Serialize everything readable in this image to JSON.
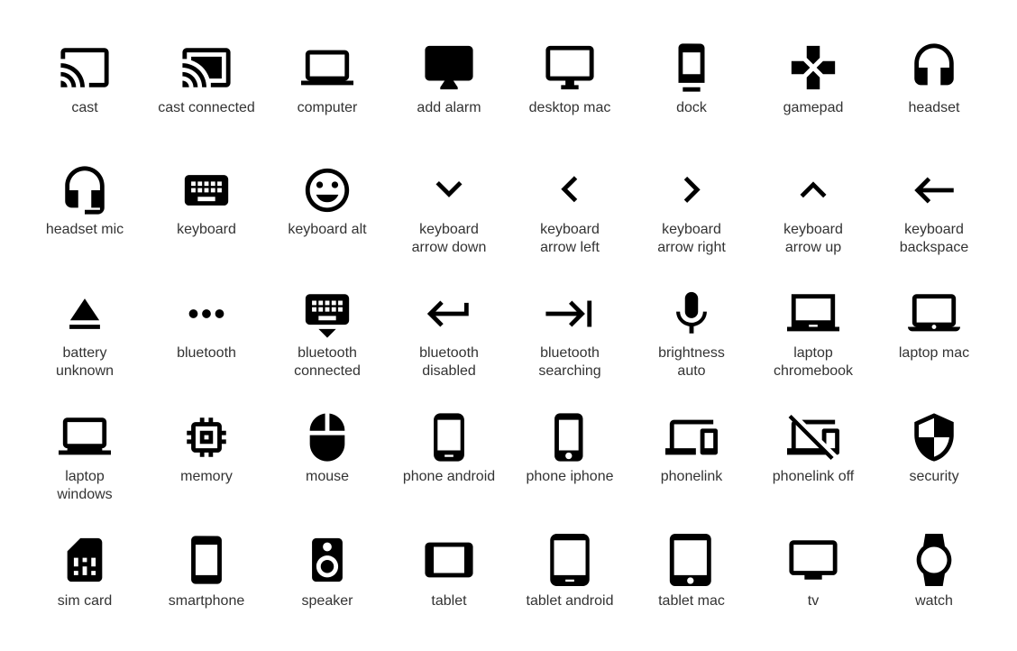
{
  "icon_color": "#000000",
  "text_color": "#333333",
  "icons": [
    {
      "name": "cast",
      "label": "cast"
    },
    {
      "name": "cast-connected",
      "label": "cast connected"
    },
    {
      "name": "computer",
      "label": "computer"
    },
    {
      "name": "desktop-filled",
      "label": "add alarm"
    },
    {
      "name": "desktop-mac",
      "label": "desktop mac"
    },
    {
      "name": "dock",
      "label": "dock"
    },
    {
      "name": "gamepad",
      "label": "gamepad"
    },
    {
      "name": "headset",
      "label": "headset"
    },
    {
      "name": "headset-mic",
      "label": "headset mic"
    },
    {
      "name": "keyboard",
      "label": "keyboard"
    },
    {
      "name": "smiley-face",
      "label": "keyboard alt"
    },
    {
      "name": "chevron-down",
      "label": "keyboard\narrow down"
    },
    {
      "name": "chevron-left",
      "label": "keyboard\narrow left"
    },
    {
      "name": "chevron-right",
      "label": "keyboard\narrow right"
    },
    {
      "name": "chevron-up",
      "label": "keyboard\narrow up"
    },
    {
      "name": "arrow-left",
      "label": "keyboard\nbackspace"
    },
    {
      "name": "eject",
      "label": "battery\nunknown"
    },
    {
      "name": "more-horiz",
      "label": "bluetooth"
    },
    {
      "name": "keyboard-hide",
      "label": "bluetooth\nconnected"
    },
    {
      "name": "keyboard-return",
      "label": "bluetooth\ndisabled"
    },
    {
      "name": "keyboard-tab",
      "label": "bluetooth\nsearching"
    },
    {
      "name": "mic",
      "label": "brightness\nauto"
    },
    {
      "name": "laptop-chromebook",
      "label": "laptop\nchromebook"
    },
    {
      "name": "laptop-mac",
      "label": "laptop mac"
    },
    {
      "name": "laptop-windows",
      "label": "laptop\nwindows"
    },
    {
      "name": "memory",
      "label": "memory"
    },
    {
      "name": "mouse",
      "label": "mouse"
    },
    {
      "name": "phone-android",
      "label": "phone android"
    },
    {
      "name": "phone-iphone",
      "label": "phone iphone"
    },
    {
      "name": "phonelink",
      "label": "phonelink"
    },
    {
      "name": "phonelink-off",
      "label": "phonelink off"
    },
    {
      "name": "security",
      "label": "security"
    },
    {
      "name": "sim-card",
      "label": "sim card"
    },
    {
      "name": "smartphone",
      "label": "smartphone"
    },
    {
      "name": "speaker",
      "label": "speaker"
    },
    {
      "name": "tablet",
      "label": "tablet"
    },
    {
      "name": "tablet-android",
      "label": "tablet android"
    },
    {
      "name": "tablet-mac",
      "label": "tablet mac"
    },
    {
      "name": "tv",
      "label": "tv"
    },
    {
      "name": "watch",
      "label": "watch"
    }
  ]
}
